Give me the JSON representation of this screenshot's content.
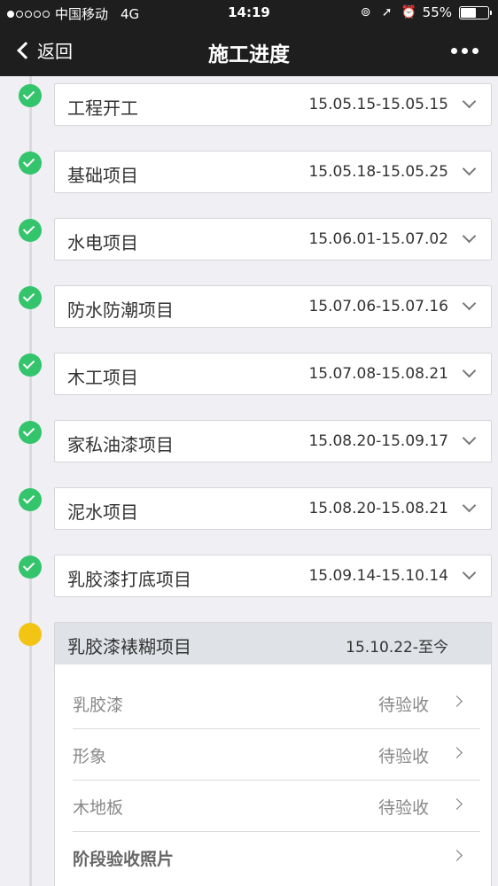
{
  "status_bar": {
    "carrier": "中国移动",
    "network": "4G",
    "time": "14:19",
    "battery": "55%",
    "battery_level": 0.55,
    "icons": [
      "rotation-lock-icon",
      "location-arrow-icon",
      "alarm-icon"
    ]
  },
  "nav": {
    "back_label": "返回",
    "title": "施工进度",
    "more_icon": "more-dots-icon"
  },
  "colors": {
    "done": "#33c46c",
    "current": "#f2c413",
    "header_bg": "#1e1e1f"
  },
  "stages": [
    {
      "name": "工程开工",
      "date": "15.05.15-15.05.15",
      "status": "done"
    },
    {
      "name": "基础项目",
      "date": "15.05.18-15.05.25",
      "status": "done"
    },
    {
      "name": "水电项目",
      "date": "15.06.01-15.07.02",
      "status": "done"
    },
    {
      "name": "防水防潮项目",
      "date": "15.07.06-15.07.16",
      "status": "done"
    },
    {
      "name": "木工项目",
      "date": "15.07.08-15.08.21",
      "status": "done"
    },
    {
      "name": "家私油漆项目",
      "date": "15.08.20-15.09.17",
      "status": "done"
    },
    {
      "name": "泥水项目",
      "date": "15.08.20-15.08.21",
      "status": "done"
    },
    {
      "name": "乳胶漆打底项目",
      "date": "15.09.14-15.10.14",
      "status": "done"
    }
  ],
  "current_stage": {
    "name": "乳胶漆裱糊项目",
    "date": "15.10.22-至今",
    "items": [
      {
        "name": "乳胶漆",
        "status": "待验收"
      },
      {
        "name": "形象",
        "status": "待验收"
      },
      {
        "name": "木地板",
        "status": "待验收"
      },
      {
        "name": "阶段验收照片",
        "status": ""
      }
    ]
  }
}
